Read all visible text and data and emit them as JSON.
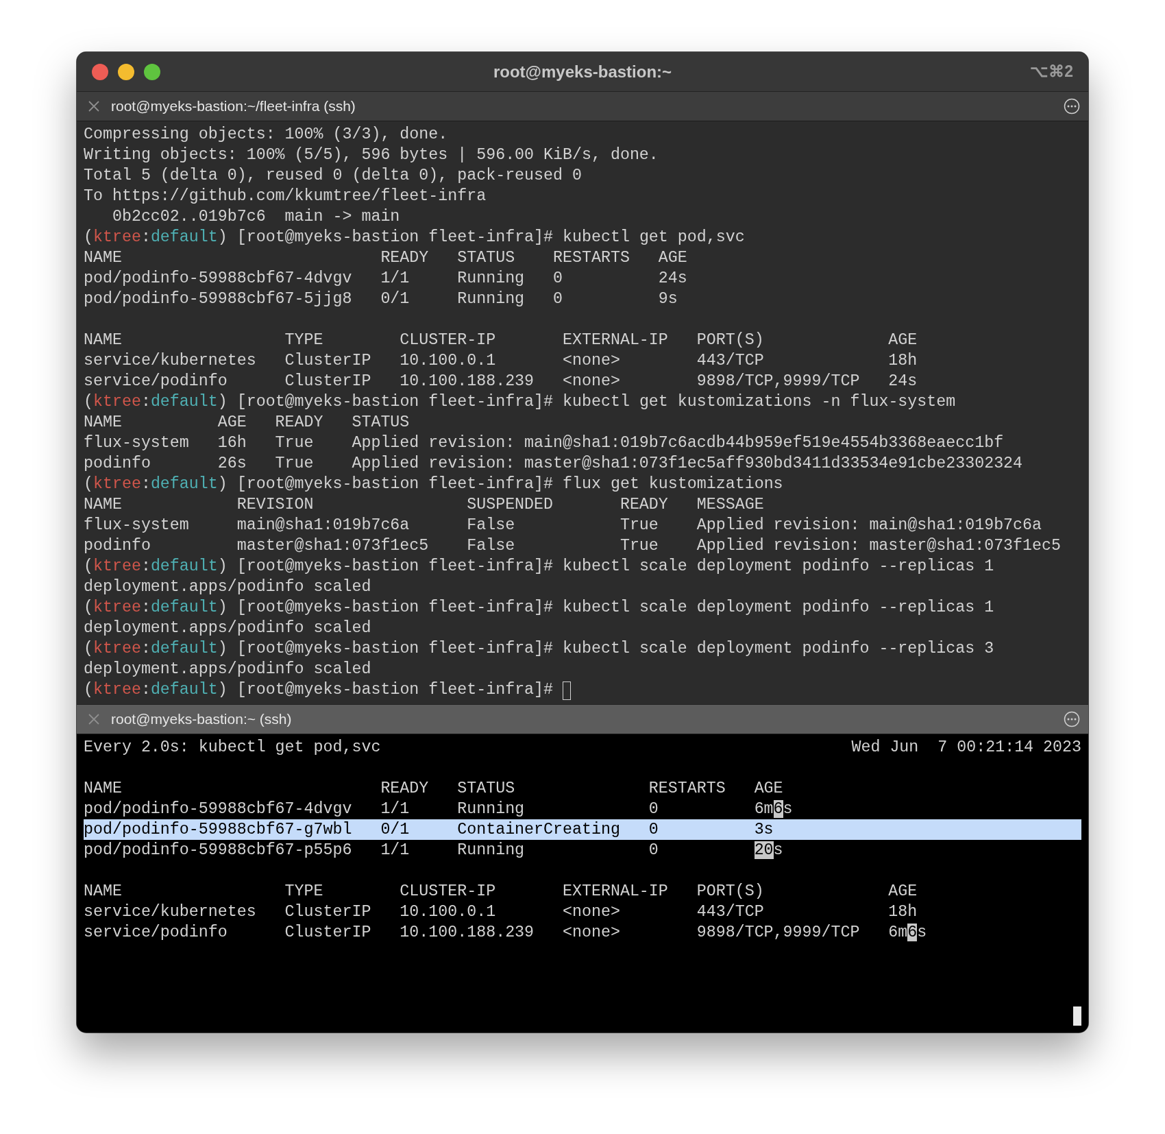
{
  "window": {
    "title": "root@myeks-bastion:~",
    "shortcut": "⌥⌘2"
  },
  "panes": [
    {
      "tab": {
        "title": "root@myeks-bastion:~/fleet-infra (ssh)",
        "active": false
      },
      "lines": [
        {
          "text": "Compressing objects: 100% (3/3), done."
        },
        {
          "text": "Writing objects: 100% (5/5), 596 bytes | 596.00 KiB/s, done."
        },
        {
          "text": "Total 5 (delta 0), reused 0 (delta 0), pack-reused 0"
        },
        {
          "text": "To https://github.com/kkumtree/fleet-infra"
        },
        {
          "text": "   0b2cc02..019b7c6  main -> main"
        },
        {
          "parts": [
            {
              "kind": "plain",
              "text": "("
            },
            {
              "kind": "context",
              "text": "ktree"
            },
            {
              "kind": "plain",
              "text": ":"
            },
            {
              "kind": "namespace",
              "text": "default"
            },
            {
              "kind": "plain",
              "text": ") [root@myeks-bastion fleet-infra]# kubectl get pod,svc"
            }
          ]
        },
        {
          "text": "NAME                           READY   STATUS    RESTARTS   AGE"
        },
        {
          "text": "pod/podinfo-59988cbf67-4dvgv   1/1     Running   0          24s"
        },
        {
          "text": "pod/podinfo-59988cbf67-5jjg8   0/1     Running   0          9s"
        },
        {
          "blank_before": true,
          "text": "NAME                 TYPE        CLUSTER-IP       EXTERNAL-IP   PORT(S)             AGE"
        },
        {
          "text": "service/kubernetes   ClusterIP   10.100.0.1       <none>        443/TCP             18h"
        },
        {
          "text": "service/podinfo      ClusterIP   10.100.188.239   <none>        9898/TCP,9999/TCP   24s"
        },
        {
          "parts": [
            {
              "kind": "plain",
              "text": "("
            },
            {
              "kind": "context",
              "text": "ktree"
            },
            {
              "kind": "plain",
              "text": ":"
            },
            {
              "kind": "namespace",
              "text": "default"
            },
            {
              "kind": "plain",
              "text": ") [root@myeks-bastion fleet-infra]# kubectl get kustomizations -n flux-system"
            }
          ]
        },
        {
          "text": "NAME          AGE   READY   STATUS"
        },
        {
          "text": "flux-system   16h   True    Applied revision: main@sha1:019b7c6acdb44b959ef519e4554b3368eaecc1bf"
        },
        {
          "text": "podinfo       26s   True    Applied revision: master@sha1:073f1ec5aff930bd3411d33534e91cbe23302324"
        },
        {
          "parts": [
            {
              "kind": "plain",
              "text": "("
            },
            {
              "kind": "context",
              "text": "ktree"
            },
            {
              "kind": "plain",
              "text": ":"
            },
            {
              "kind": "namespace",
              "text": "default"
            },
            {
              "kind": "plain",
              "text": ") [root@myeks-bastion fleet-infra]# flux get kustomizations"
            }
          ]
        },
        {
          "text": "NAME            REVISION                SUSPENDED       READY   MESSAGE"
        },
        {
          "text": "flux-system     main@sha1:019b7c6a      False           True    Applied revision: main@sha1:019b7c6a"
        },
        {
          "text": "podinfo         master@sha1:073f1ec5    False           True    Applied revision: master@sha1:073f1ec5"
        },
        {
          "parts": [
            {
              "kind": "plain",
              "text": "("
            },
            {
              "kind": "context",
              "text": "ktree"
            },
            {
              "kind": "plain",
              "text": ":"
            },
            {
              "kind": "namespace",
              "text": "default"
            },
            {
              "kind": "plain",
              "text": ") [root@myeks-bastion fleet-infra]# kubectl scale deployment podinfo --replicas 1"
            }
          ]
        },
        {
          "text": "deployment.apps/podinfo scaled"
        },
        {
          "parts": [
            {
              "kind": "plain",
              "text": "("
            },
            {
              "kind": "context",
              "text": "ktree"
            },
            {
              "kind": "plain",
              "text": ":"
            },
            {
              "kind": "namespace",
              "text": "default"
            },
            {
              "kind": "plain",
              "text": ") [root@myeks-bastion fleet-infra]# kubectl scale deployment podinfo --replicas 1"
            }
          ]
        },
        {
          "text": "deployment.apps/podinfo scaled"
        },
        {
          "parts": [
            {
              "kind": "plain",
              "text": "("
            },
            {
              "kind": "context",
              "text": "ktree"
            },
            {
              "kind": "plain",
              "text": ":"
            },
            {
              "kind": "namespace",
              "text": "default"
            },
            {
              "kind": "plain",
              "text": ") [root@myeks-bastion fleet-infra]# kubectl scale deployment podinfo --replicas 3"
            }
          ]
        },
        {
          "text": "deployment.apps/podinfo scaled"
        },
        {
          "parts": [
            {
              "kind": "plain",
              "text": "("
            },
            {
              "kind": "context",
              "text": "ktree"
            },
            {
              "kind": "plain",
              "text": ":"
            },
            {
              "kind": "namespace",
              "text": "default"
            },
            {
              "kind": "plain",
              "text": ") [root@myeks-bastion fleet-infra]# "
            }
          ]
        }
      ]
    },
    {
      "tab": {
        "title": "root@myeks-bastion:~ (ssh)",
        "active": true
      },
      "header": {
        "command": "Every 2.0s: kubectl get pod,svc",
        "time": "Wed Jun  7 00:21:14 2023"
      },
      "lines": [
        {
          "blank_before": true,
          "selected": false,
          "parts": [
            {
              "kind": "plain",
              "text": "NAME                           READY   STATUS              RESTARTS   AGE"
            }
          ]
        },
        {
          "selected": false,
          "parts": [
            {
              "kind": "plain",
              "text": "pod/podinfo-59988cbf67-4dvgv   1/1     Running             0          6m"
            },
            {
              "kind": "changed",
              "text": "6"
            },
            {
              "kind": "plain",
              "text": "s"
            }
          ]
        },
        {
          "selected": true,
          "parts": [
            {
              "kind": "plain",
              "text": "pod/podinfo-59988cbf67-g7wbl   0/1     ContainerCreating   0          3s"
            }
          ]
        },
        {
          "selected": false,
          "parts": [
            {
              "kind": "plain",
              "text": "pod/podinfo-59988cbf67-p55p6   1/1     Running             0          "
            },
            {
              "kind": "changed",
              "text": "20"
            },
            {
              "kind": "plain",
              "text": "s"
            }
          ]
        },
        {
          "blank_before": true,
          "selected": false,
          "parts": [
            {
              "kind": "plain",
              "text": "NAME                 TYPE        CLUSTER-IP       EXTERNAL-IP   PORT(S)             AGE"
            }
          ]
        },
        {
          "selected": false,
          "parts": [
            {
              "kind": "plain",
              "text": "service/kubernetes   ClusterIP   10.100.0.1       <none>        443/TCP             18h"
            }
          ]
        },
        {
          "selected": false,
          "parts": [
            {
              "kind": "plain",
              "text": "service/podinfo      ClusterIP   10.100.188.239   <none>        9898/TCP,9999/TCP   6m"
            },
            {
              "kind": "changed",
              "text": "6"
            },
            {
              "kind": "plain",
              "text": "s"
            }
          ]
        }
      ]
    }
  ]
}
